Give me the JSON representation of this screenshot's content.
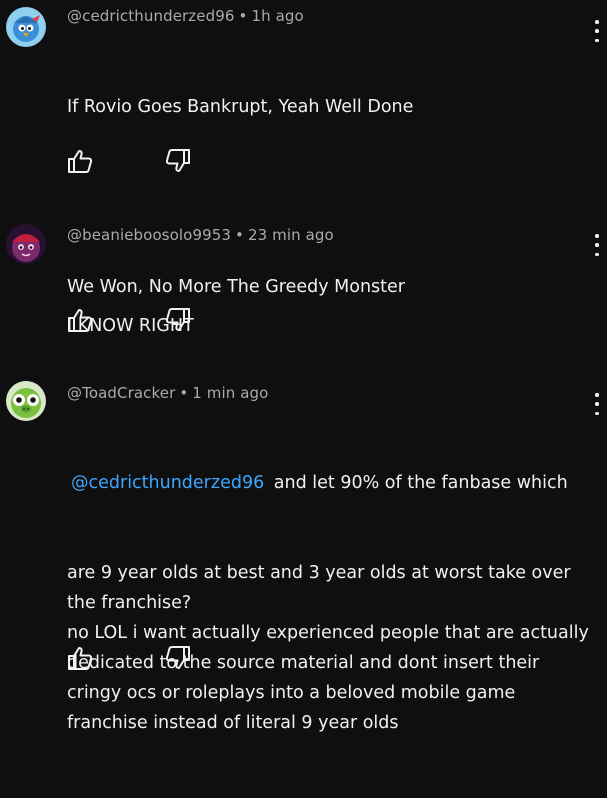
{
  "comments": [
    {
      "handle": "@cedricthunderzed96",
      "time": "1h ago",
      "line1": "If Rovio Goes Bankrupt, Yeah Well Done",
      "line2": "We Won, No More The Greedy Monster",
      "avatar_icon": "blue-bird-avatar"
    },
    {
      "handle": "@beanieboosolo9953",
      "time": "23 min ago",
      "line1": "I KNOW RIGHT",
      "avatar_icon": "purple-character-avatar"
    },
    {
      "handle": "@ToadCracker",
      "time": "1 min ago",
      "mention": "@cedricthunderzed96",
      "text_first": " and let 90% of the fanbase which",
      "text_rest": "are 9 year olds at best and 3 year olds at worst take over\nthe franchise?\nno LOL i want actually experienced people that are actually\ndedicated to the source material and dont insert their\ncringy ocs or roleplays into a beloved mobile game\nfranchise instead of literal 9 year olds",
      "avatar_icon": "green-pig-avatar"
    }
  ],
  "meta_separator": "•",
  "icons": {
    "like": "thumbs-up-icon",
    "dislike": "thumbs-down-icon",
    "menu": "more-vertical-icon"
  },
  "colors": {
    "background": "#0f0f0f",
    "text": "#f1f1f1",
    "meta": "#aaaaaa",
    "mention": "#3ea6ff"
  }
}
